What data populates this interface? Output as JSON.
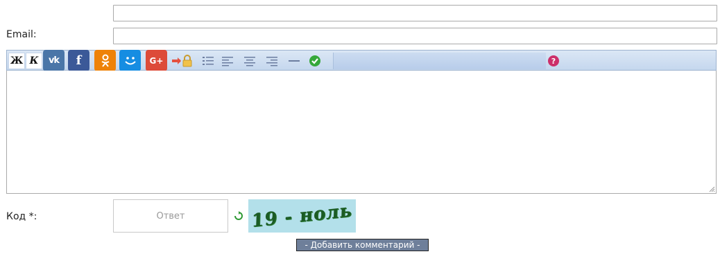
{
  "form": {
    "email_label": "Email:",
    "code_label": "Код *:",
    "name_value": "",
    "email_value": ""
  },
  "toolbar": {
    "bold_label": "Ж",
    "italic_label": "К"
  },
  "social": {
    "vk": "vk",
    "facebook": "f",
    "odnoklassniki": "ok",
    "moimir": "mm",
    "googleplus": "G+"
  },
  "captcha": {
    "placeholder": "Ответ",
    "image_text": "19 - ноль"
  },
  "submit_label": "- Добавить комментарий -",
  "colors": {
    "vk": "#4a76a8",
    "facebook": "#3b5998",
    "odnoklassniki": "#ee8208",
    "moimir": "#168de2",
    "googleplus": "#dd4b39",
    "captcha_bg": "#b3e0ea",
    "toolbar_bg": "#c5d7ee"
  }
}
